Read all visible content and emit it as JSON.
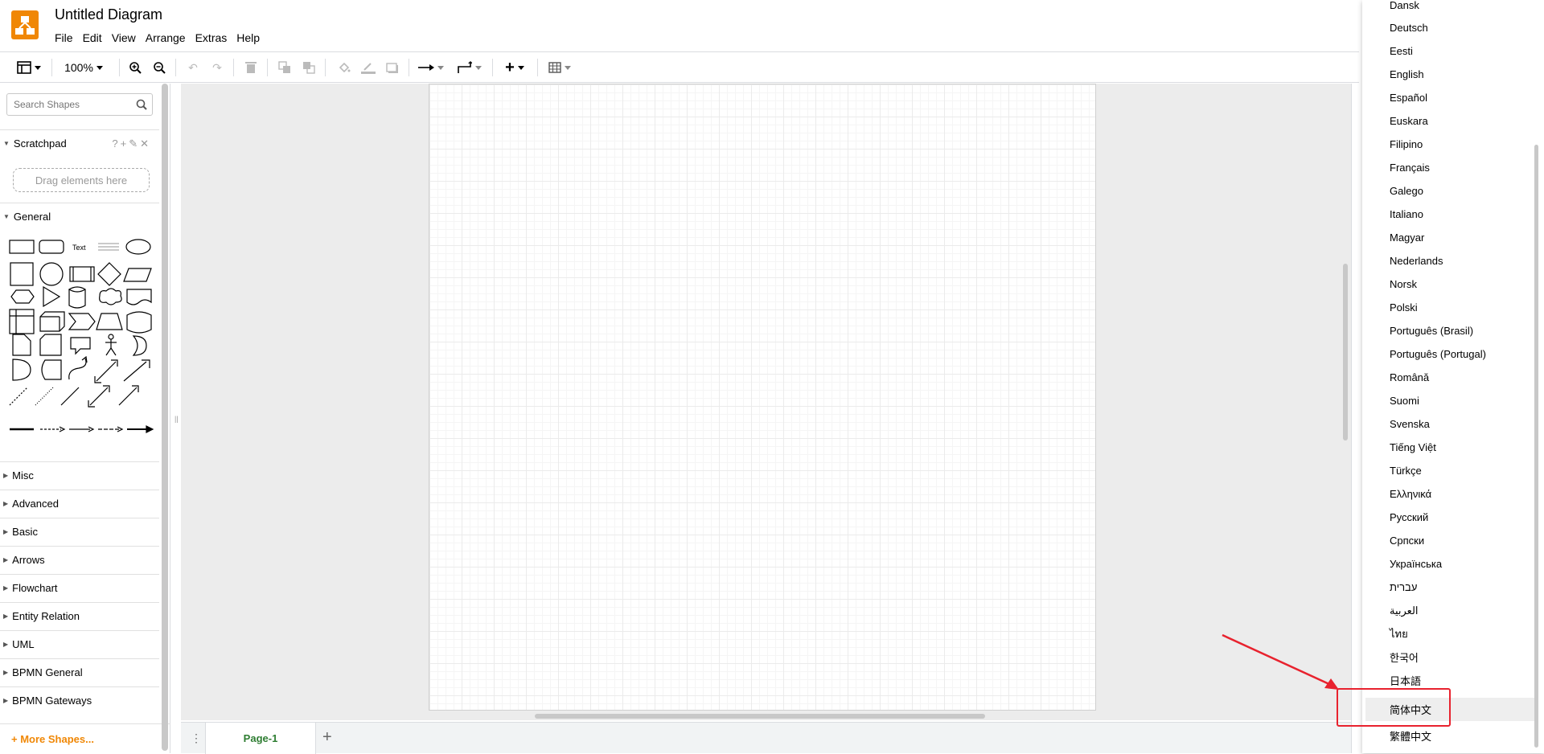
{
  "header": {
    "title": "Untitled Diagram",
    "menu": [
      "File",
      "Edit",
      "View",
      "Arrange",
      "Extras",
      "Help"
    ]
  },
  "toolbar": {
    "zoom": "100%",
    "icons": [
      "format-panel-icon",
      "zoom-in-icon",
      "zoom-out-icon",
      "undo-icon",
      "redo-icon",
      "delete-icon",
      "to-front-icon",
      "to-back-icon",
      "fill-color-icon",
      "line-color-icon",
      "shadow-icon",
      "connection-icon",
      "waypoints-icon",
      "insert-icon",
      "table-icon"
    ]
  },
  "sidebar": {
    "search_placeholder": "Search Shapes",
    "scratchpad": {
      "label": "Scratchpad",
      "drag_hint": "Drag elements here"
    },
    "general_label": "General",
    "shape_text_label": "Text",
    "sections": [
      "Misc",
      "Advanced",
      "Basic",
      "Arrows",
      "Flowchart",
      "Entity Relation",
      "UML",
      "BPMN General",
      "BPMN Gateways"
    ],
    "more_shapes": "+ More Shapes..."
  },
  "footer": {
    "page_tab": "Page-1",
    "add_page": "+"
  },
  "language_menu": {
    "items": [
      "Dansk",
      "Deutsch",
      "Eesti",
      "English",
      "Español",
      "Euskara",
      "Filipino",
      "Français",
      "Galego",
      "Italiano",
      "Magyar",
      "Nederlands",
      "Norsk",
      "Polski",
      "Português (Brasil)",
      "Português (Portugal)",
      "Română",
      "Suomi",
      "Svenska",
      "Tiếng Việt",
      "Türkçe",
      "Ελληνικά",
      "Русский",
      "Српски",
      "Українська",
      "עברית",
      "العربية",
      "ไทย",
      "한국어",
      "日本語",
      "简体中文",
      "繁體中文"
    ],
    "highlighted": "简体中文"
  },
  "colors": {
    "brand": "#f08705",
    "annotation": "#e8222e",
    "page_tab_text": "#2e7d32"
  }
}
